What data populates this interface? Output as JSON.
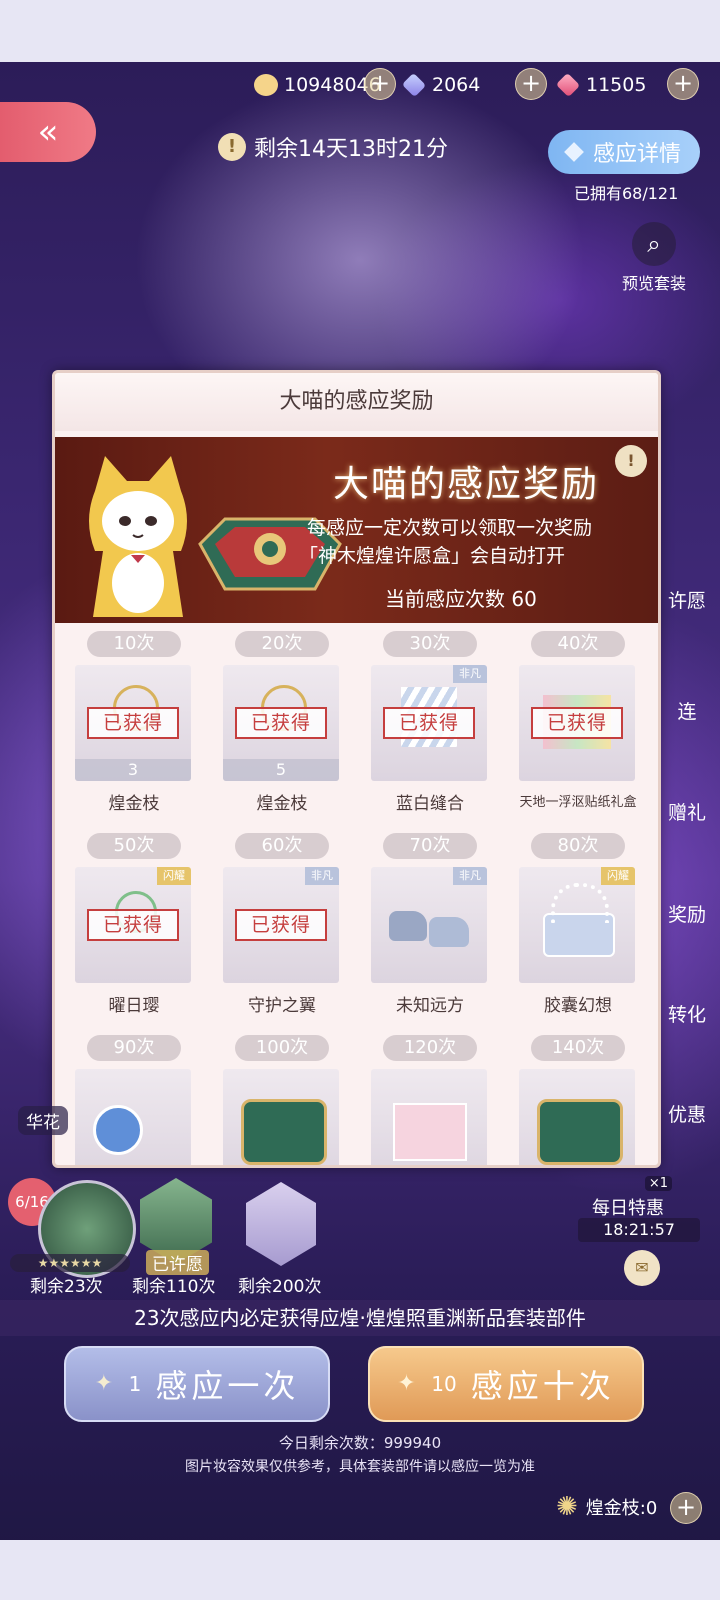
{
  "currencies": [
    {
      "icon": "cat-coin-icon",
      "value": "10948046"
    },
    {
      "icon": "diamond-icon",
      "value": "2064"
    },
    {
      "icon": "pink-crystal-icon",
      "value": "11505"
    }
  ],
  "header": {
    "back_icon": "double-chevron-left-icon",
    "timer": "剩余14天13时21分",
    "detail_button": "感应详情",
    "owned": "已拥有68/121",
    "preview_label": "预览套装"
  },
  "right_menu": [
    "许愿",
    "连",
    "赠礼",
    "奖励",
    "转化",
    "优惠"
  ],
  "modal": {
    "title": "大喵的感应奖励",
    "banner_title": "大喵的感应奖励",
    "banner_line1": "每感应一定次数可以领取一次奖励",
    "banner_line2": "「神木煌煌许愿盒」会自动打开",
    "current_count": "当前感应次数 60",
    "stamp_text": "已获得",
    "rewards": [
      {
        "count": "10次",
        "name": "煌金枝",
        "qty": "3",
        "claimed": true,
        "tag": ""
      },
      {
        "count": "20次",
        "name": "煌金枝",
        "qty": "5",
        "claimed": true,
        "tag": ""
      },
      {
        "count": "30次",
        "name": "蓝白缝合",
        "qty": "",
        "claimed": true,
        "tag": "非凡"
      },
      {
        "count": "40次",
        "name": "天地一浮沤贴纸礼盒",
        "qty": "",
        "claimed": true,
        "tag": ""
      },
      {
        "count": "50次",
        "name": "曜日璎",
        "qty": "",
        "claimed": true,
        "tag": "闪耀"
      },
      {
        "count": "60次",
        "name": "守护之翼",
        "qty": "",
        "claimed": true,
        "tag": "非凡"
      },
      {
        "count": "70次",
        "name": "未知远方",
        "qty": "",
        "claimed": false,
        "tag": "非凡"
      },
      {
        "count": "80次",
        "name": "胶囊幻想",
        "qty": "",
        "claimed": false,
        "tag": "闪耀"
      },
      {
        "count": "90次",
        "name": "",
        "qty": "",
        "claimed": false,
        "tag": ""
      },
      {
        "count": "100次",
        "name": "",
        "qty": "",
        "claimed": false,
        "tag": ""
      },
      {
        "count": "120次",
        "name": "",
        "qty": "",
        "claimed": false,
        "tag": ""
      },
      {
        "count": "140次",
        "name": "",
        "qty": "",
        "claimed": false,
        "tag": ""
      }
    ]
  },
  "bottom": {
    "side_label": "华花",
    "progress_badge": "6/16",
    "wished_label": "已许愿",
    "remaining": [
      "剩余23次",
      "剩余110次",
      "剩余200次"
    ],
    "pity_text": "23次感应内必定获得应煌·煌煌照重渊新品套装部件",
    "single_num": "1",
    "single_label": "感应一次",
    "ten_num": "10",
    "ten_label": "感应十次",
    "daily_remaining": "今日剩余次数：999940",
    "disclaimer": "图片妆容效果仅供参考，具体套装部件请以感应一览为准",
    "branch_label": "煌金枝:0",
    "daily_deal_label": "每日特惠",
    "daily_deal_badge": "×1",
    "daily_deal_timer": "18:21:57"
  },
  "colors": {
    "accent_red": "#c53e3e",
    "back_button": "#e35d6e",
    "detail_button": "#7fb6f2",
    "gold_button": "#e09a57"
  }
}
